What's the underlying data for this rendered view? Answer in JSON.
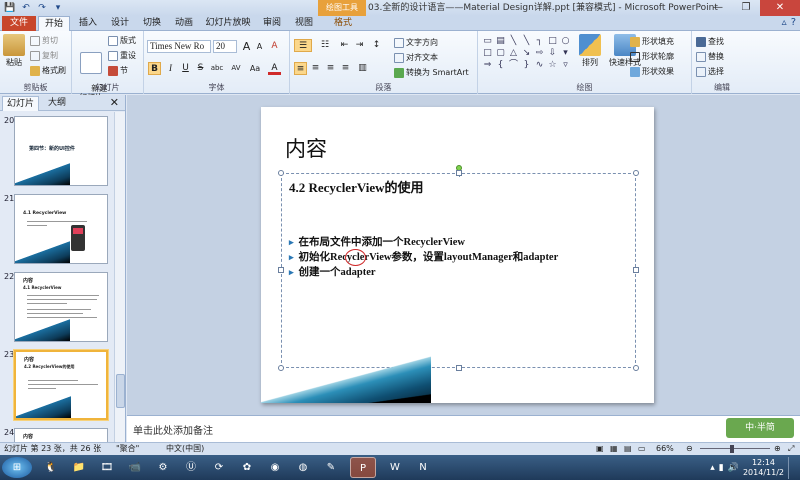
{
  "titlebar": {
    "context_tab": "绘图工具",
    "document_title": "03.全新的设计语言——Material Design详解.ppt [兼容模式] - Microsoft PowerPoint",
    "minimize": "—",
    "maximize": "❐",
    "close": "✕"
  },
  "qat": {
    "save": "💾",
    "undo": "↶",
    "redo": "↷",
    "customize": "▾"
  },
  "tabs": {
    "file": "文件",
    "home": "开始",
    "insert": "插入",
    "design": "设计",
    "transitions": "切换",
    "animations": "动画",
    "slideshow": "幻灯片放映",
    "review": "审阅",
    "view": "视图",
    "format": "格式"
  },
  "ribbon": {
    "clipboard": {
      "label": "剪贴板",
      "paste": "粘贴",
      "cut": "剪切",
      "copy": "复制",
      "format_painter": "格式刷"
    },
    "slides": {
      "label": "幻灯片",
      "new_slide": "新建\n幻灯片",
      "layout": "版式",
      "reset": "重设",
      "section": "节"
    },
    "font": {
      "label": "字体",
      "font_name": "Times New Ro",
      "font_size": "20",
      "bold": "B",
      "italic": "I",
      "underline": "U",
      "strike": "S",
      "shadow": "abc",
      "spacing": "AV",
      "case": "Aa",
      "color": "A",
      "grow": "A",
      "shrink": "A",
      "clear": "A"
    },
    "paragraph": {
      "label": "段落",
      "text_direction": "文字方向",
      "align_text": "对齐文本",
      "smartart": "转换为 SmartArt"
    },
    "drawing": {
      "label": "绘图",
      "arrange": "排列",
      "quick_styles": "快速样式",
      "shape_fill": "形状填充",
      "shape_outline": "形状轮廓",
      "shape_effects": "形状效果"
    },
    "editing": {
      "label": "编辑",
      "find": "查找",
      "replace": "替换",
      "select": "选择"
    }
  },
  "left_panel": {
    "tab_slides": "幻灯片",
    "tab_outline": "大纲",
    "close": "✕",
    "thumbnails": [
      {
        "number": "20",
        "title": "第四节：新的UI控件",
        "subtitle": ""
      },
      {
        "number": "21",
        "title": "4.1  RecyclerView",
        "subtitle": ""
      },
      {
        "number": "22",
        "title": "内容",
        "subtitle": "4.1  RecyclerView"
      },
      {
        "number": "23",
        "title": "内容",
        "subtitle": "4.2  RecyclerView的使用"
      },
      {
        "number": "24",
        "title": "内容",
        "subtitle": ""
      }
    ]
  },
  "slide": {
    "title": "内容",
    "subtitle": "4.2  RecyclerView的使用",
    "bullets": [
      "在布局文件中添加一个RecyclerView",
      "初始化RecyclerView参数，设置layoutManager和adapter",
      "创建一个adapter"
    ]
  },
  "notes": {
    "placeholder": "单击此处添加备注",
    "watermark": "中·半简"
  },
  "statusbar": {
    "slide_info": "幻灯片 第 23 张，共 26 张",
    "theme": "\"聚合\"",
    "language": "中文(中国)",
    "zoom": "66%"
  },
  "taskbar": {
    "time": "12:14",
    "date": "2014/11/2"
  },
  "colors": {
    "file_tab": "#c8462b",
    "context_tab": "#e8a13b",
    "accent_blue": "#2b78b5",
    "ink_red": "#d02a2a"
  }
}
